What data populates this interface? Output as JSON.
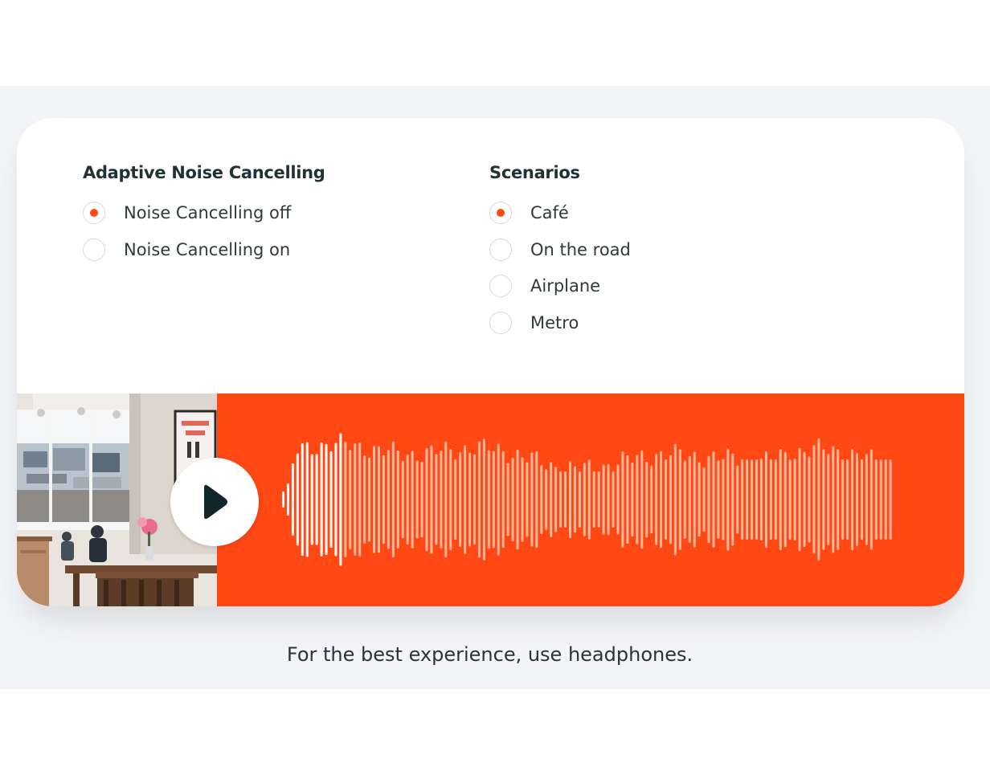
{
  "anc": {
    "title": "Adaptive Noise Cancelling",
    "options": [
      {
        "label": "Noise Cancelling off",
        "checked": true
      },
      {
        "label": "Noise Cancelling on",
        "checked": false
      }
    ]
  },
  "scenarios": {
    "title": "Scenarios",
    "options": [
      {
        "label": "Café",
        "checked": true
      },
      {
        "label": "On the road",
        "checked": false
      },
      {
        "label": "Airplane",
        "checked": false
      },
      {
        "label": "Metro",
        "checked": false
      }
    ]
  },
  "player": {
    "background_color": "#ff4813",
    "play_icon": "play-icon",
    "scene_image": "cafe-interior-photo",
    "progress_fraction": 0.1
  },
  "caption": "For the best experience, use headphones.",
  "colors": {
    "accent": "#ff4813",
    "text": "#1f3237",
    "band": "#f3f4f7"
  }
}
